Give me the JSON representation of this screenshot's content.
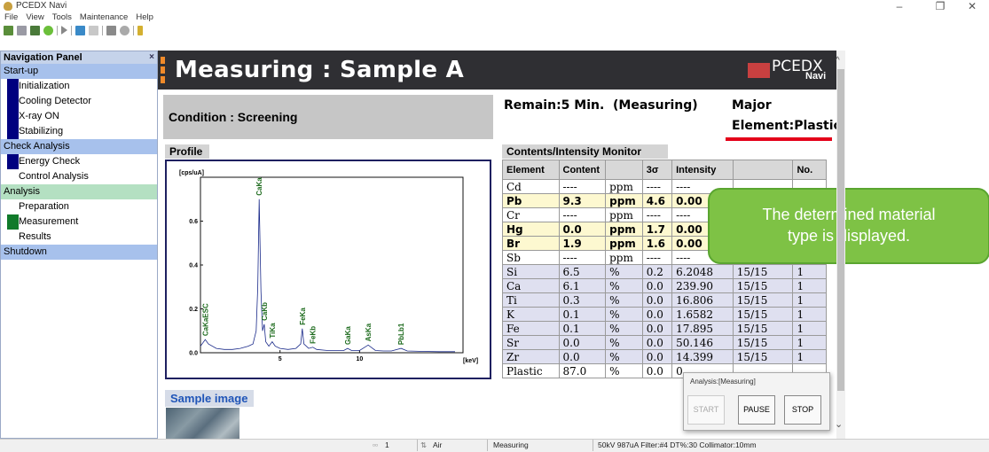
{
  "window": {
    "title": "PCEDX Navi",
    "min": "–",
    "max": "❐",
    "close": "✕"
  },
  "menu": [
    "File",
    "View",
    "Tools",
    "Maintenance",
    "Help"
  ],
  "nav": {
    "title": "Navigation Panel",
    "close": "×",
    "rows": [
      {
        "label": "Start-up",
        "kind": "cat"
      },
      {
        "label": "Initialization",
        "kind": "item",
        "mark": "#00007f"
      },
      {
        "label": "Cooling Detector",
        "kind": "item",
        "mark": "#00007f"
      },
      {
        "label": "X-ray ON",
        "kind": "item",
        "mark": "#00007f"
      },
      {
        "label": "Stabilizing",
        "kind": "item",
        "mark": "#00007f"
      },
      {
        "label": "Check Analysis",
        "kind": "cat"
      },
      {
        "label": "Energy Check",
        "kind": "item",
        "mark": "#00007f"
      },
      {
        "label": "Control Analysis",
        "kind": "item"
      },
      {
        "label": "Analysis",
        "kind": "cat-green"
      },
      {
        "label": "Preparation",
        "kind": "item"
      },
      {
        "label": "Measurement",
        "kind": "item",
        "mark": "#107a2a"
      },
      {
        "label": "Results",
        "kind": "item"
      },
      {
        "label": "Shutdown",
        "kind": "cat"
      }
    ]
  },
  "header": {
    "title": "Measuring : Sample A",
    "logo": "PCEDX",
    "logo_sub": "Navi"
  },
  "condition": "Condition : Screening",
  "status": {
    "remain": "Remain:5 Min.",
    "state": "(Measuring)",
    "major": "Major",
    "element": "Element:Plastic"
  },
  "profile": {
    "label": "Profile"
  },
  "table": {
    "label": "Contents/Intensity Monitor",
    "headers": [
      "Element",
      "Content",
      "",
      "3σ",
      "Intensity",
      "",
      "No."
    ],
    "rows": [
      {
        "el": "Cd",
        "content": "----",
        "unit": "ppm",
        "sigma": "----",
        "intensity": "----",
        "ratio": "",
        "no": "",
        "style": "pl"
      },
      {
        "el": "Pb",
        "content": "9.3",
        "unit": "ppm",
        "sigma": "4.6",
        "intensity": "0.00",
        "ratio": "",
        "no": "",
        "style": "hl"
      },
      {
        "el": "Cr",
        "content": "----",
        "unit": "ppm",
        "sigma": "----",
        "intensity": "----",
        "ratio": "",
        "no": "",
        "style": "pl"
      },
      {
        "el": "Hg",
        "content": "0.0",
        "unit": "ppm",
        "sigma": "1.7",
        "intensity": "0.00",
        "ratio": "",
        "no": "",
        "style": "hl"
      },
      {
        "el": "Br",
        "content": "1.9",
        "unit": "ppm",
        "sigma": "1.6",
        "intensity": "0.00",
        "ratio": "",
        "no": "",
        "style": "hl"
      },
      {
        "el": "Sb",
        "content": "----",
        "unit": "ppm",
        "sigma": "----",
        "intensity": "----",
        "ratio": "",
        "no": "",
        "style": "pl"
      },
      {
        "el": "Si",
        "content": "6.5",
        "unit": "%",
        "sigma": "0.2",
        "intensity": "6.2048",
        "ratio": "15/15",
        "no": "1",
        "style": "ll"
      },
      {
        "el": "Ca",
        "content": "6.1",
        "unit": "%",
        "sigma": "0.0",
        "intensity": "239.90",
        "ratio": "15/15",
        "no": "1",
        "style": "ll"
      },
      {
        "el": "Ti",
        "content": "0.3",
        "unit": "%",
        "sigma": "0.0",
        "intensity": "16.806",
        "ratio": "15/15",
        "no": "1",
        "style": "ll"
      },
      {
        "el": "K",
        "content": "0.1",
        "unit": "%",
        "sigma": "0.0",
        "intensity": "1.6582",
        "ratio": "15/15",
        "no": "1",
        "style": "ll"
      },
      {
        "el": "Fe",
        "content": "0.1",
        "unit": "%",
        "sigma": "0.0",
        "intensity": "17.895",
        "ratio": "15/15",
        "no": "1",
        "style": "ll"
      },
      {
        "el": "Sr",
        "content": "0.0",
        "unit": "%",
        "sigma": "0.0",
        "intensity": "50.146",
        "ratio": "15/15",
        "no": "1",
        "style": "ll"
      },
      {
        "el": "Zr",
        "content": "0.0",
        "unit": "%",
        "sigma": "0.0",
        "intensity": "14.399",
        "ratio": "15/15",
        "no": "1",
        "style": "ll"
      },
      {
        "el": "Plastic",
        "content": "87.0",
        "unit": "%",
        "sigma": "0.0",
        "intensity": "0",
        "ratio": "",
        "no": "",
        "style": "pl"
      }
    ]
  },
  "callout": {
    "line1": "The determined material",
    "line2": "type is displayed.",
    "color": "#7ec245"
  },
  "sample": {
    "label": "Sample image"
  },
  "popup": {
    "title": "Analysis:[Measuring]",
    "start": "START",
    "pause": "PAUSE",
    "stop": "STOP"
  },
  "statusbar": {
    "count": "1",
    "atmos": "Air",
    "state": "Measuring",
    "cond": "50kV  987uA  Filter:#4  DT%:30  Collimator:10mm"
  },
  "chart_data": {
    "type": "line",
    "title": "",
    "ylabel": "[cps/uA]",
    "xlabel": "[keV]",
    "xlim": [
      0,
      16.5
    ],
    "ylim": [
      0,
      0.8
    ],
    "xticks": [
      5,
      10
    ],
    "yticks": [
      0.0,
      0.2,
      0.4,
      0.6
    ],
    "peak_labels": [
      {
        "label": "CaKaESC",
        "x": 0.3
      },
      {
        "label": "CaKa",
        "x": 3.69
      },
      {
        "label": "CaKb",
        "x": 4.01
      },
      {
        "label": "TiKa",
        "x": 4.51
      },
      {
        "label": "FeKa",
        "x": 6.4
      },
      {
        "label": "FeKb",
        "x": 7.06
      },
      {
        "label": "GaKa",
        "x": 9.25
      },
      {
        "label": "AsKa",
        "x": 10.54
      },
      {
        "label": "PbLb1",
        "x": 12.61
      }
    ],
    "series": [
      {
        "x": [
          0,
          0.3,
          0.5,
          1.0,
          1.5,
          2.0,
          2.5,
          3.0,
          3.3,
          3.5,
          3.6,
          3.69,
          3.8,
          3.9,
          4.01,
          4.1,
          4.3,
          4.51,
          4.7,
          5.0,
          5.5,
          6.0,
          6.3,
          6.4,
          6.5,
          6.8,
          7.06,
          7.3,
          8.0,
          8.5,
          9.0,
          9.25,
          9.5,
          10.0,
          10.54,
          11.0,
          11.5,
          12.0,
          12.61,
          13.0,
          14.0,
          15.0,
          16.0
        ],
        "y": [
          0.03,
          0.06,
          0.04,
          0.02,
          0.015,
          0.015,
          0.02,
          0.03,
          0.04,
          0.1,
          0.3,
          0.7,
          0.28,
          0.1,
          0.13,
          0.05,
          0.03,
          0.05,
          0.03,
          0.02,
          0.015,
          0.02,
          0.04,
          0.11,
          0.04,
          0.02,
          0.025,
          0.015,
          0.01,
          0.01,
          0.01,
          0.02,
          0.01,
          0.01,
          0.035,
          0.01,
          0.008,
          0.008,
          0.02,
          0.008,
          0.006,
          0.005,
          0.005
        ]
      }
    ]
  }
}
